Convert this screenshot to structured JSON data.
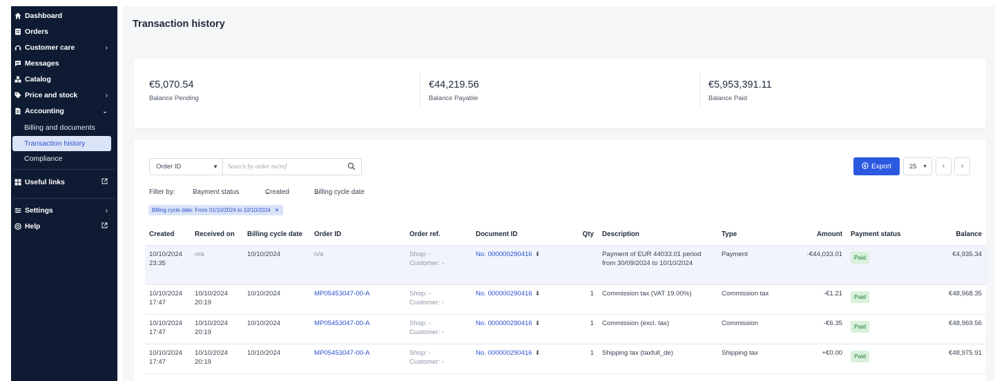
{
  "sidebar": {
    "items": [
      {
        "label": "Dashboard",
        "icon": "home-icon"
      },
      {
        "label": "Orders",
        "icon": "orders-icon"
      },
      {
        "label": "Customer care",
        "icon": "headset-icon"
      },
      {
        "label": "Messages",
        "icon": "message-icon"
      },
      {
        "label": "Catalog",
        "icon": "catalog-icon"
      },
      {
        "label": "Price and stock",
        "icon": "tag-icon"
      },
      {
        "label": "Accounting",
        "icon": "document-icon"
      },
      {
        "label": "Useful links",
        "icon": "grid-icon"
      },
      {
        "label": "Settings",
        "icon": "sliders-icon"
      },
      {
        "label": "Help",
        "icon": "help-icon"
      }
    ],
    "accounting_sub": [
      "Billing and documents",
      "Transaction history",
      "Compliance"
    ]
  },
  "page": {
    "title": "Transaction history"
  },
  "balances": [
    {
      "value": "€5,070.54",
      "label": "Balance Pending"
    },
    {
      "value": "€44,219.56",
      "label": "Balance Payable"
    },
    {
      "value": "€5,953,391.11",
      "label": "Balance Paid"
    }
  ],
  "search": {
    "field": "Order ID",
    "placeholder": "Search by order no/ref"
  },
  "toolbar": {
    "export_label": "Export",
    "per_page": "25"
  },
  "filters": {
    "label": "Filter by:",
    "payment_status": "Payment status",
    "created": "Created",
    "billing_cycle": "Billing cycle date",
    "active_chip": "Billing cycle date: From 01/10/2024 to 10/10/2024"
  },
  "table": {
    "headers": {
      "created": "Created",
      "received": "Received on",
      "billing": "Billing cycle date",
      "order_id": "Order ID",
      "order_ref": "Order ref.",
      "document": "Document ID",
      "qty": "Qty",
      "description": "Description",
      "type": "Type",
      "amount": "Amount",
      "status": "Payment status",
      "balance": "Balance"
    },
    "rows": [
      {
        "created_date": "10/10/2024",
        "created_time": "23:35",
        "received_date": "n/a",
        "received_time": "",
        "billing": "10/10/2024",
        "order_id": "n/a",
        "shop": "Shop:  -",
        "customer": "Customer:  -",
        "document": "No. 000000290416",
        "qty": "",
        "description": "Payment of EUR 44033.01 period from 30/09/2024 to 10/10/2024",
        "type": "Payment",
        "amount": "-€44,033.01",
        "status": "Paid",
        "balance": "€4,935.34"
      },
      {
        "created_date": "10/10/2024",
        "created_time": "17:47",
        "received_date": "10/10/2024",
        "received_time": "20:19",
        "billing": "10/10/2024",
        "order_id": "MP05453047-00-A",
        "shop": "Shop:  -",
        "customer": "Customer:  -",
        "document": "No. 000000290416",
        "qty": "1",
        "description": "Commission tax (VAT 19.00%)",
        "type": "Commission tax",
        "amount": "-€1.21",
        "status": "Paid",
        "balance": "€48,968.35"
      },
      {
        "created_date": "10/10/2024",
        "created_time": "17:47",
        "received_date": "10/10/2024",
        "received_time": "20:19",
        "billing": "10/10/2024",
        "order_id": "MP05453047-00-A",
        "shop": "Shop:  -",
        "customer": "Customer:  -",
        "document": "No. 000000290416",
        "qty": "1",
        "description": "Commission (excl. tax)",
        "type": "Commission",
        "amount": "-€6.35",
        "status": "Paid",
        "balance": "€48,969.56"
      },
      {
        "created_date": "10/10/2024",
        "created_time": "17:47",
        "received_date": "10/10/2024",
        "received_time": "20:19",
        "billing": "10/10/2024",
        "order_id": "MP05453047-00-A",
        "shop": "Shop:  -",
        "customer": "Customer:  -",
        "document": "No. 000000290416",
        "qty": "1",
        "description": "Shipping tax (taxfull_de)",
        "type": "Shipping tax",
        "amount": "+€0.00",
        "status": "Paid",
        "balance": "€48,975.91"
      }
    ]
  },
  "colors": {
    "sidebar_bg": "#0e1b33",
    "accent": "#2b59e0",
    "paid_bg": "#d8f0dc",
    "paid_text": "#1e7a35"
  }
}
